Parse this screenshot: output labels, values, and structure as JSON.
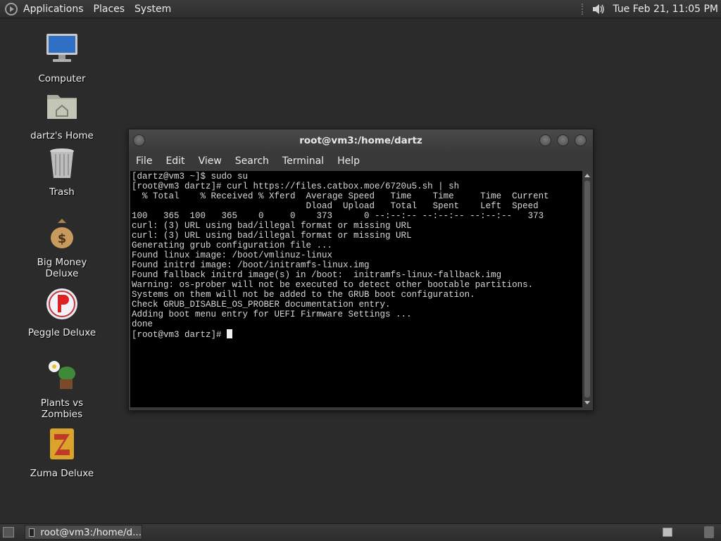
{
  "top_panel": {
    "menus": [
      "Applications",
      "Places",
      "System"
    ],
    "clock": "Tue Feb 21, 11:05 PM"
  },
  "desktop_icons": [
    {
      "label": "Computer",
      "icon": "computer-icon"
    },
    {
      "label": "dartz's Home",
      "icon": "home-folder-icon"
    },
    {
      "label": "Trash",
      "icon": "trash-icon"
    },
    {
      "label": "Big Money Deluxe",
      "icon": "money-bag-icon"
    },
    {
      "label": "Peggle Deluxe",
      "icon": "peggle-icon"
    },
    {
      "label": "Plants vs Zombies",
      "icon": "plants-vs-zombies-icon"
    },
    {
      "label": "Zuma Deluxe",
      "icon": "zuma-icon"
    }
  ],
  "terminal": {
    "title": "root@vm3:/home/dartz",
    "menus": [
      "File",
      "Edit",
      "View",
      "Search",
      "Terminal",
      "Help"
    ],
    "lines": [
      "[dartz@vm3 ~]$ sudo su",
      "[root@vm3 dartz]# curl https://files.catbox.moe/6720u5.sh | sh",
      "  % Total    % Received % Xferd  Average Speed   Time    Time     Time  Current",
      "                                 Dload  Upload   Total   Spent    Left  Speed",
      "100   365  100   365    0     0    373      0 --:--:-- --:--:-- --:--:--   373",
      "curl: (3) URL using bad/illegal format or missing URL",
      "curl: (3) URL using bad/illegal format or missing URL",
      "Generating grub configuration file ...",
      "Found linux image: /boot/vmlinuz-linux",
      "Found initrd image: /boot/initramfs-linux.img",
      "Found fallback initrd image(s) in /boot:  initramfs-linux-fallback.img",
      "Warning: os-prober will not be executed to detect other bootable partitions.",
      "Systems on them will not be added to the GRUB boot configuration.",
      "Check GRUB_DISABLE_OS_PROBER documentation entry.",
      "Adding boot menu entry for UEFI Firmware Settings ...",
      "done"
    ],
    "prompt": "[root@vm3 dartz]# "
  },
  "bottom_panel": {
    "task": "root@vm3:/home/d..."
  }
}
